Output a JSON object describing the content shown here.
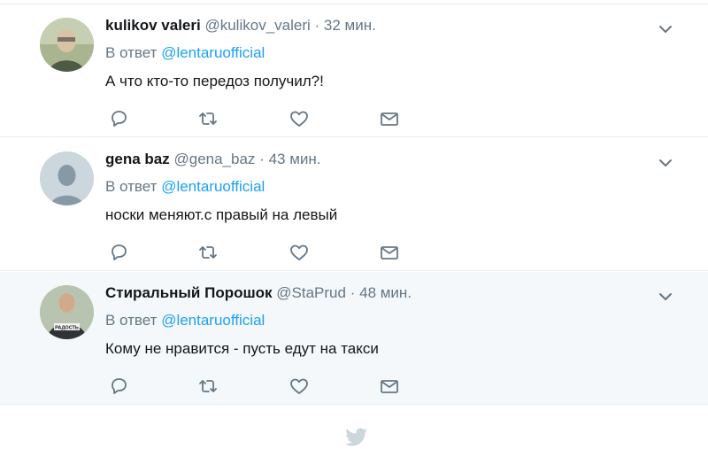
{
  "tweets": [
    {
      "name": "kulikov valeri",
      "handle": "@kulikov_valeri",
      "separator": "·",
      "time": "32 мин.",
      "reply_prefix": "В ответ",
      "reply_to": "@lentaruofficial",
      "text": "А что кто-то передоз получил?!",
      "avatar": "person-photo-icon"
    },
    {
      "name": "gena baz",
      "handle": "@gena_baz",
      "separator": "·",
      "time": "43 мин.",
      "reply_prefix": "В ответ",
      "reply_to": "@lentaruofficial",
      "text": "носки меняют.с правый на левый",
      "avatar": "default-avatar-icon"
    },
    {
      "name": "Стиральный Порошок",
      "handle": "@StaPrud",
      "separator": "·",
      "time": "48 мин.",
      "reply_prefix": "В ответ",
      "reply_to": "@lentaruofficial",
      "text": "Кому не нравится - пусть едут на такси",
      "avatar": "person-photo-icon",
      "avatar_shirt_text": "РАДОСТЬ"
    }
  ],
  "actions": [
    "reply-icon",
    "retweet-icon",
    "like-icon",
    "message-icon"
  ],
  "footer": {
    "icon": "twitter-bird-icon"
  },
  "colors": {
    "link": "#1da1f2",
    "muted": "#657786",
    "text": "#14171a",
    "border": "#e6ecf0",
    "highlight_bg": "#f5f8fa"
  }
}
